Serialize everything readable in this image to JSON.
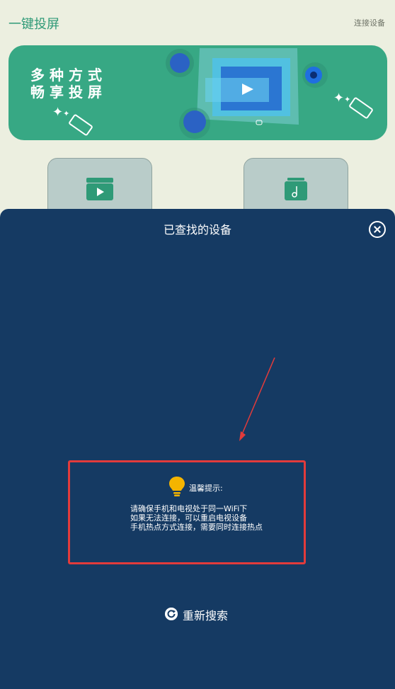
{
  "header": {
    "app_title": "一键投屏",
    "connect_label": "连接设备"
  },
  "banner": {
    "line1": "多种方式",
    "line2": "畅享投屏"
  },
  "cards": [
    {
      "icon": "video-clapper-icon"
    },
    {
      "icon": "music-folder-icon"
    }
  ],
  "sheet": {
    "title": "已查找的设备",
    "tip_title": "温馨提示:",
    "tip_lines": [
      "请确保手机和电视处于同一WiFi下",
      "如果无法连接，可以重启电视设备",
      "手机热点方式连接，需要同时连接热点"
    ],
    "refresh_label": "重新搜索"
  },
  "colors": {
    "accent": "#37a884",
    "sheet_bg": "#153a63",
    "highlight_border": "#e23b3b",
    "bulb": "#f4b400"
  }
}
